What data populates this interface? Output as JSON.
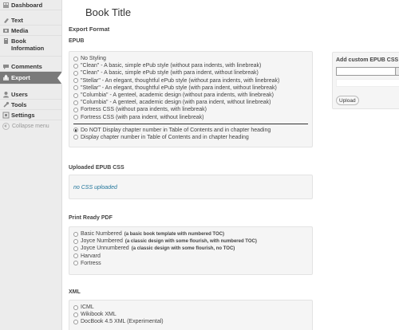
{
  "sidebar": {
    "items": [
      {
        "label": "Dashboard",
        "icon": "dashboard-icon"
      },
      {
        "label": "Text",
        "icon": "text-icon"
      },
      {
        "label": "Media",
        "icon": "media-icon"
      },
      {
        "label": "Book Information",
        "icon": "book-info-icon"
      },
      {
        "label": "Comments",
        "icon": "comments-icon"
      },
      {
        "label": "Export",
        "icon": "export-icon",
        "active": true
      },
      {
        "label": "Users",
        "icon": "users-icon"
      },
      {
        "label": "Tools",
        "icon": "tools-icon"
      },
      {
        "label": "Settings",
        "icon": "settings-icon"
      }
    ],
    "collapse_label": "Collapse menu"
  },
  "page_title": "Book Title",
  "export_format_heading": "Export Format",
  "epub": {
    "heading": "EPUB",
    "styles": [
      {
        "label": "No Styling",
        "checked": false
      },
      {
        "label": "\"Clean\" - A basic, simple ePub style (without para indents, with linebreak)",
        "checked": false
      },
      {
        "label": "\"Clean\" - A basic, simple ePub style (with para indent, without linebreak)",
        "checked": false
      },
      {
        "label": "\"Stellar\" - An elegant, thoughtful ePub style (without para indents, with linebreak)",
        "checked": false
      },
      {
        "label": "\"Stellar\" - An elegant, thoughtful ePub style (with para indent, without linebreak)",
        "checked": false
      },
      {
        "label": "\"Columbia\" - A genteel, academic design (without para indents, with linebreak)",
        "checked": false
      },
      {
        "label": "\"Columbia\" - A genteel, academic design (with para indent, without linebreak)",
        "checked": false
      },
      {
        "label": "Fortress CSS (without para indents, with linebreak)",
        "checked": false
      },
      {
        "label": "Fortress CSS (with para indent, without linebreak)",
        "checked": false
      }
    ],
    "chapter_options": [
      {
        "label": "Do NOT Display chapter number in Table of Contents and in chapter heading",
        "checked": true
      },
      {
        "label": "Display chapter number in Table of Contents and in chapter heading",
        "checked": false
      }
    ]
  },
  "custom_css": {
    "heading": "Add custom EPUB CSS",
    "upload_label": "Upload"
  },
  "uploaded_css": {
    "heading": "Uploaded EPUB CSS",
    "empty_text": "no CSS uploaded"
  },
  "pdf": {
    "heading": "Print Ready PDF",
    "options": [
      {
        "label": "Basic Numbered",
        "note": "(a basic book template with numbered TOC)"
      },
      {
        "label": "Joyce Numbered",
        "note": "(a classic design with some flourish, with numbered TOC)"
      },
      {
        "label": "Joyce Unnumbered",
        "note": "(a classic design with some flourish, no TOC)"
      },
      {
        "label": "Harvard",
        "note": ""
      },
      {
        "label": "Fortress",
        "note": ""
      }
    ]
  },
  "xml": {
    "heading": "XML",
    "options": [
      {
        "label": "ICML"
      },
      {
        "label": "Wikibook XML"
      },
      {
        "label": "DocBook 4.5 XML (Experimental)"
      }
    ]
  },
  "colors": {
    "sidebar_bg": "#ececec",
    "active_item_bg": "#7a7a7a",
    "panel_bg": "#f5f5f5",
    "link": "#21759b"
  }
}
